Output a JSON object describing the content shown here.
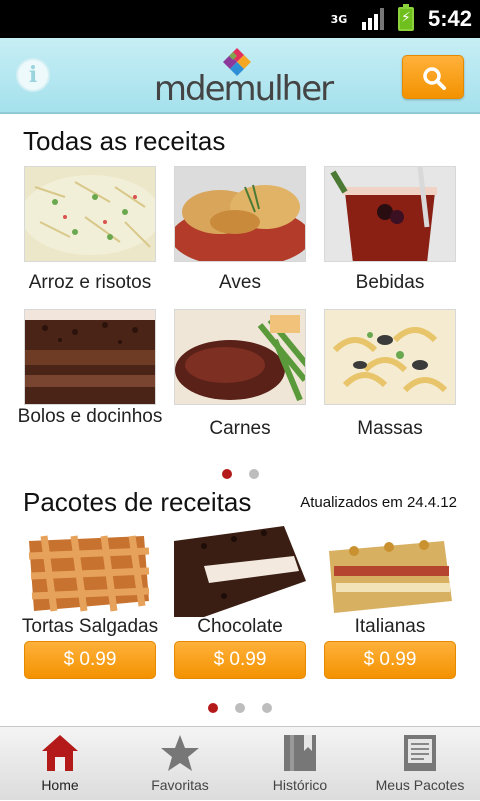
{
  "status_bar": {
    "network": "3G",
    "time": "5:42",
    "icons": [
      "3g-icon",
      "signal-icon",
      "battery-charging-icon"
    ]
  },
  "header": {
    "logo_text": "mdemulher",
    "info_icon": "info-icon",
    "search_icon": "search-icon",
    "accent": "#f39200",
    "background": "#b5e7f0"
  },
  "all_recipes": {
    "title": "Todas as receitas",
    "categories": [
      {
        "label": "Arroz e risotos"
      },
      {
        "label": "Aves"
      },
      {
        "label": "Bebidas"
      },
      {
        "label": "Bolos e docinhos"
      },
      {
        "label": "Carnes"
      },
      {
        "label": "Massas"
      }
    ],
    "pager": {
      "page": 1,
      "pages": 2
    }
  },
  "recipe_packages": {
    "title": "Pacotes de receitas",
    "updated": "Atualizados em 24.4.12",
    "packages": [
      {
        "label": "Tortas Salgadas",
        "price": "$ 0.99"
      },
      {
        "label": "Chocolate",
        "price": "$ 0.99"
      },
      {
        "label": "Italianas",
        "price": "$ 0.99"
      }
    ],
    "pager": {
      "page": 1,
      "pages": 3
    }
  },
  "tabs": [
    {
      "label": "Home",
      "icon": "home-icon",
      "active": true
    },
    {
      "label": "Favoritas",
      "icon": "star-icon",
      "active": false
    },
    {
      "label": "Histórico",
      "icon": "book-icon",
      "active": false
    },
    {
      "label": "Meus Pacotes",
      "icon": "package-icon",
      "active": false
    }
  ],
  "colors": {
    "active_tab": "#b41a1a",
    "inactive_tab": "#777777",
    "button": "#f39200"
  }
}
